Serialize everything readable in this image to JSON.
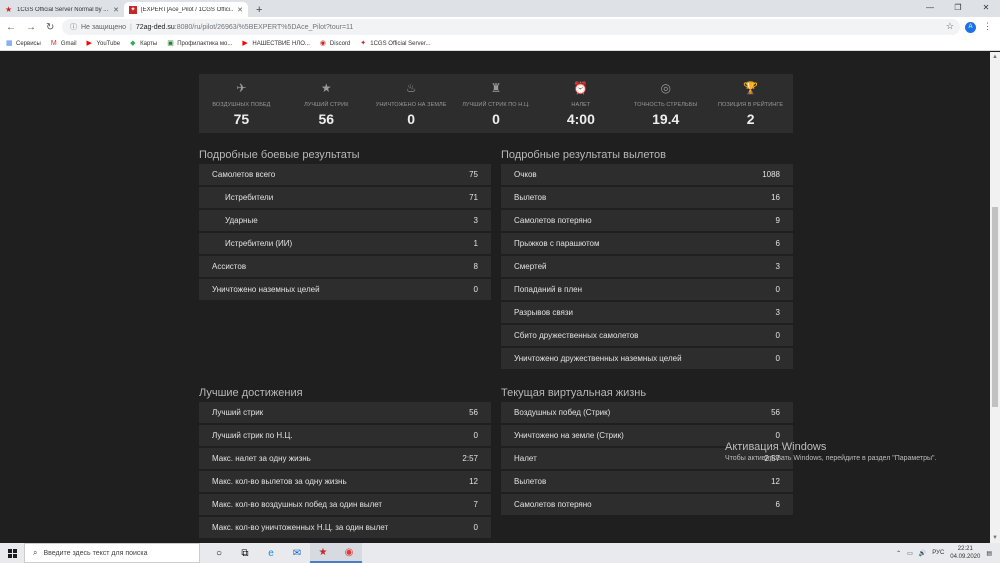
{
  "browser": {
    "tabs": [
      {
        "title": "1CGS Official Server Normal by ...",
        "active": false
      },
      {
        "title": "[EXPERT]Ace_Pilot / 1CGS Offici...",
        "active": true
      }
    ],
    "address": {
      "security": "Не защищено",
      "host": "72ag-ded.su",
      "path": ":8080/ru/pilot/26963/%5BEXPERT%5DAce_Pilot?tour=11"
    },
    "profile_initial": "A",
    "bookmarks": [
      {
        "label": "Сервисы",
        "icon": "apps-icon"
      },
      {
        "label": "Gmail",
        "icon": "gmail-icon"
      },
      {
        "label": "YouTube",
        "icon": "youtube-icon"
      },
      {
        "label": "Карты",
        "icon": "maps-icon"
      },
      {
        "label": "Профилактика мо...",
        "icon": "site-icon"
      },
      {
        "label": "НАШЕСТВИЕ НЛО...",
        "icon": "youtube-icon"
      },
      {
        "label": "Discord",
        "icon": "discord-icon"
      },
      {
        "label": "1CGS Official Server...",
        "icon": "1cgs-icon"
      }
    ]
  },
  "stats": [
    {
      "icon": "plane-icon",
      "label": "Воздушных побед",
      "value": "75"
    },
    {
      "icon": "star-icon",
      "label": "Лучший стрик",
      "value": "56"
    },
    {
      "icon": "fire-icon",
      "label": "Уничтожено на земле",
      "value": "0"
    },
    {
      "icon": "tower-icon",
      "label": "Лучший стрик по Н.Ц.",
      "value": "0"
    },
    {
      "icon": "clock-icon",
      "label": "Налет",
      "value": "4:00"
    },
    {
      "icon": "target-icon",
      "label": "Точность стрельбы",
      "value": "19.4"
    },
    {
      "icon": "trophy-icon",
      "label": "Позиция в рейтинге",
      "value": "2"
    }
  ],
  "combat": {
    "title": "Подробные боевые результаты",
    "rows": [
      {
        "label": "Самолетов всего",
        "value": "75",
        "sub": false
      },
      {
        "label": "Истребители",
        "value": "71",
        "sub": true
      },
      {
        "label": "Ударные",
        "value": "3",
        "sub": true
      },
      {
        "label": "Истребители (ИИ)",
        "value": "1",
        "sub": true
      },
      {
        "label": "Ассистов",
        "value": "8",
        "sub": false
      },
      {
        "label": "Уничтожено наземных целей",
        "value": "0",
        "sub": false
      }
    ]
  },
  "sorties": {
    "title": "Подробные результаты вылетов",
    "rows": [
      {
        "label": "Очков",
        "value": "1088"
      },
      {
        "label": "Вылетов",
        "value": "16"
      },
      {
        "label": "Самолетов потеряно",
        "value": "9"
      },
      {
        "label": "Прыжков с парашютом",
        "value": "6"
      },
      {
        "label": "Смертей",
        "value": "3"
      },
      {
        "label": "Попаданий в плен",
        "value": "0"
      },
      {
        "label": "Разрывов связи",
        "value": "3"
      },
      {
        "label": "Сбито дружественных самолетов",
        "value": "0"
      },
      {
        "label": "Уничтожено дружественных наземных целей",
        "value": "0"
      }
    ]
  },
  "best": {
    "title": "Лучшие достижения",
    "rows": [
      {
        "label": "Лучший стрик",
        "value": "56"
      },
      {
        "label": "Лучший стрик по Н.Ц.",
        "value": "0"
      },
      {
        "label": "Макс. налет за одну жизнь",
        "value": "2:57"
      },
      {
        "label": "Макс. кол-во вылетов за одну жизнь",
        "value": "12"
      },
      {
        "label": "Макс. кол-во воздушных побед за один вылет",
        "value": "7"
      },
      {
        "label": "Макс. кол-во уничтоженных Н.Ц. за один вылет",
        "value": "0"
      }
    ]
  },
  "life": {
    "title": "Текущая виртуальная жизнь",
    "rows": [
      {
        "label": "Воздушных побед (Стрик)",
        "value": "56"
      },
      {
        "label": "Уничтожено на земле (Стрик)",
        "value": "0"
      },
      {
        "label": "Налет",
        "value": "2:57"
      },
      {
        "label": "Вылетов",
        "value": "12"
      },
      {
        "label": "Самолетов потеряно",
        "value": "6"
      }
    ]
  },
  "watermark": {
    "line1": "Активация Windows",
    "line2": "Чтобы активировать Windows, перейдите в раздел \"Параметры\"."
  },
  "taskbar": {
    "search_placeholder": "Введите здесь текст для поиска",
    "lang": "РУС",
    "time": "22:21",
    "date": "04.09.2020"
  }
}
